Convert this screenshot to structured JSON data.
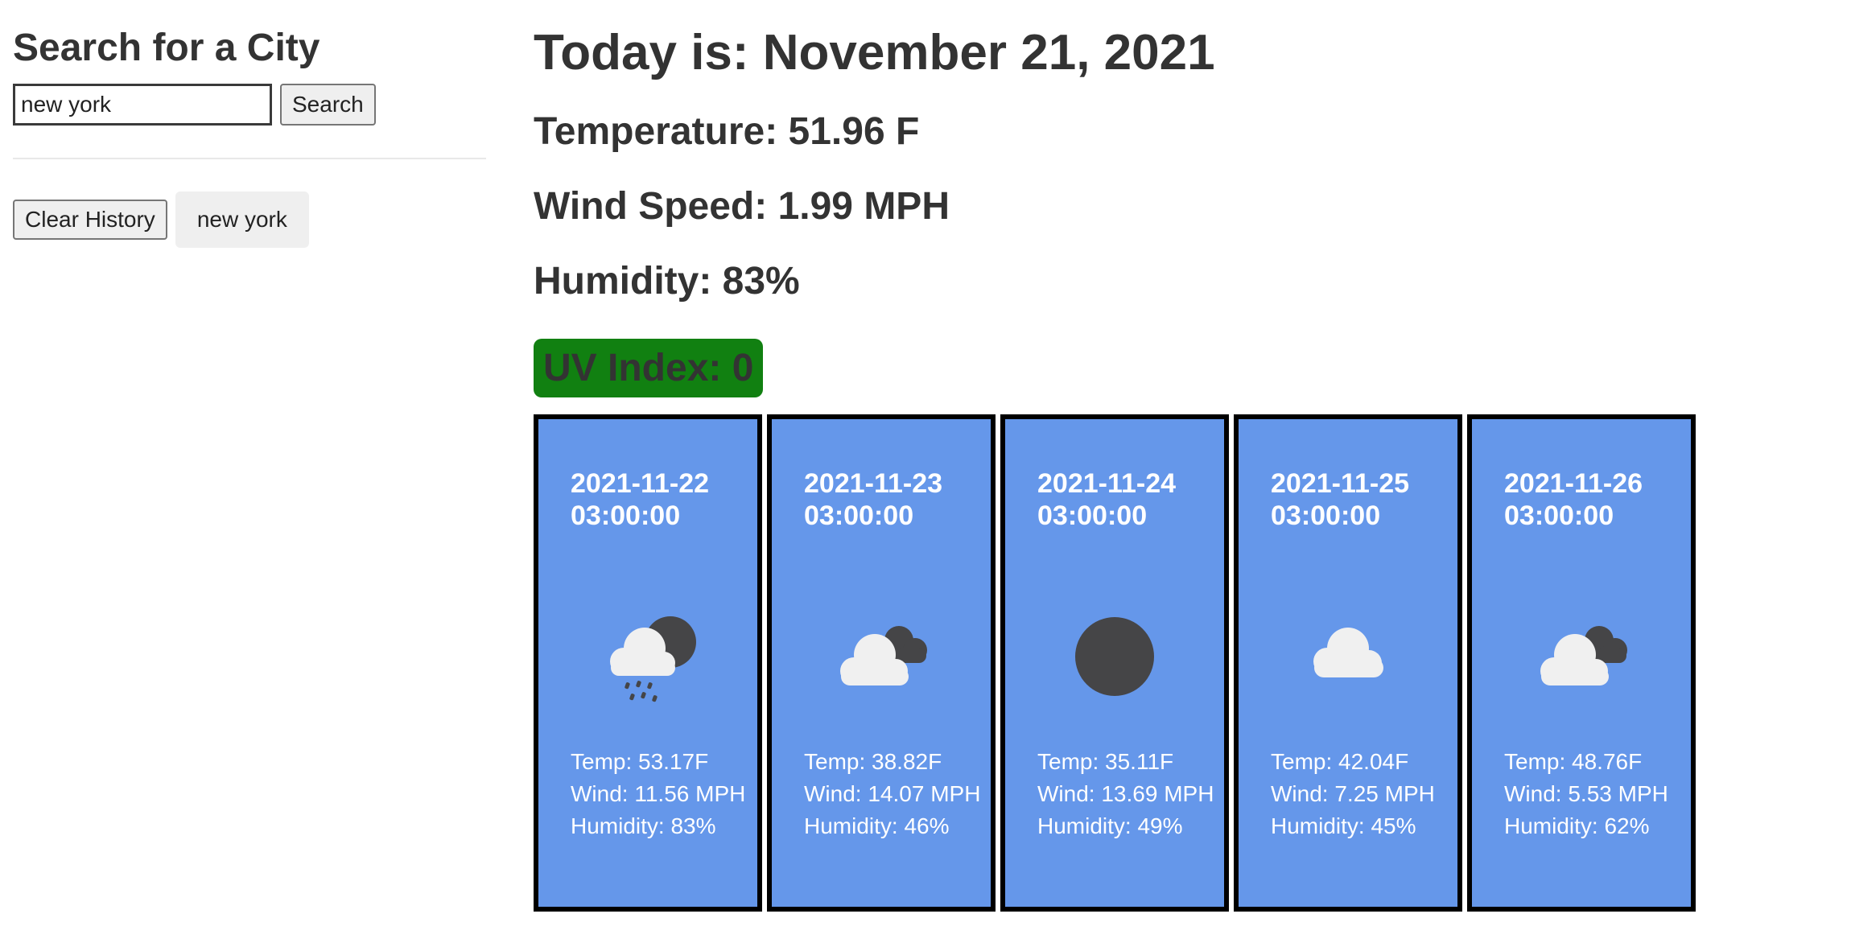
{
  "sidebar": {
    "heading": "Search for a City",
    "search": {
      "value": "new york"
    },
    "search_button": "Search",
    "clear_button": "Clear History",
    "history": [
      "new york"
    ]
  },
  "current": {
    "date": "Today is: November 21, 2021",
    "temperature": "Temperature: 51.96 F",
    "wind": "Wind Speed: 1.99 MPH",
    "humidity": "Humidity: 83%",
    "uv": "UV Index: 0",
    "uv_color": "#118011"
  },
  "forecast": [
    {
      "date": "2021-11-22 03:00:00",
      "icon": "rain-night-icon",
      "temp": "Temp: 53.17F",
      "wind": "Wind: 11.56 MPH",
      "humidity": "Humidity: 83%"
    },
    {
      "date": "2021-11-23 03:00:00",
      "icon": "broken-clouds-icon",
      "temp": "Temp: 38.82F",
      "wind": "Wind: 14.07 MPH",
      "humidity": "Humidity: 46%"
    },
    {
      "date": "2021-11-24 03:00:00",
      "icon": "clear-night-icon",
      "temp": "Temp: 35.11F",
      "wind": "Wind: 13.69 MPH",
      "humidity": "Humidity: 49%"
    },
    {
      "date": "2021-11-25 03:00:00",
      "icon": "cloud-icon",
      "temp": "Temp: 42.04F",
      "wind": "Wind: 7.25 MPH",
      "humidity": "Humidity: 45%"
    },
    {
      "date": "2021-11-26 03:00:00",
      "icon": "broken-clouds-icon",
      "temp": "Temp: 48.76F",
      "wind": "Wind: 5.53 MPH",
      "humidity": "Humidity: 62%"
    }
  ],
  "colors": {
    "card_background": "#6597ea",
    "card_border": "#000000",
    "text": "#333333"
  }
}
